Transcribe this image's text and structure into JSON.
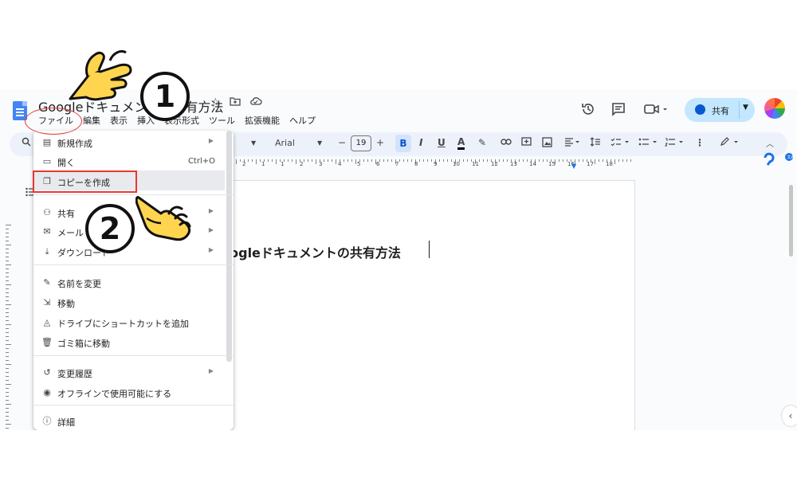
{
  "document": {
    "title": "Googleドキュメントの共有方法",
    "body_heading": "Googleドキュメントの共有方法"
  },
  "menubar": [
    "ファイル",
    "編集",
    "表示",
    "挿入",
    "表示形式",
    "ツール",
    "拡張機能",
    "ヘルプ"
  ],
  "header": {
    "share_label": "共有"
  },
  "toolbar": {
    "font_name": "Arial",
    "font_size": "19",
    "buttons": [
      "B",
      "I",
      "U",
      "A"
    ]
  },
  "ruler": {
    "numbers": [
      "2",
      "1",
      "1",
      "2",
      "3",
      "4",
      "5",
      "6",
      "7",
      "8",
      "9",
      "10",
      "11",
      "12",
      "13",
      "14",
      "15",
      "16",
      "17",
      "18"
    ]
  },
  "file_menu": {
    "items": [
      {
        "label": "新規作成",
        "icon": "new-doc-icon",
        "submenu": true
      },
      {
        "label": "開く",
        "icon": "folder-icon",
        "shortcut": "Ctrl+O"
      },
      {
        "label": "コピーを作成",
        "icon": "copy-icon",
        "highlighted": true
      },
      {
        "label": "共有",
        "icon": "person-add-icon",
        "submenu": true
      },
      {
        "label": "メール",
        "icon": "mail-icon",
        "submenu": true
      },
      {
        "label": "ダウンロード",
        "icon": "download-icon",
        "submenu": true
      },
      {
        "label": "名前を変更",
        "icon": "rename-icon"
      },
      {
        "label": "移動",
        "icon": "move-folder-icon"
      },
      {
        "label": "ドライブにショートカットを追加",
        "icon": "drive-shortcut-icon"
      },
      {
        "label": "ゴミ箱に移動",
        "icon": "trash-icon"
      },
      {
        "label": "変更履歴",
        "icon": "history-icon",
        "submenu": true
      },
      {
        "label": "オフラインで使用可能にする",
        "icon": "offline-icon"
      },
      {
        "label": "詳細",
        "icon": "info-icon"
      }
    ]
  },
  "annotations": {
    "step1": "1",
    "step2": "2",
    "highlight_color": "#e53935"
  },
  "colors": {
    "accent": "#0b57d0",
    "share_bg": "#c2e7ff",
    "toolbar_bg": "#edf2fa"
  }
}
